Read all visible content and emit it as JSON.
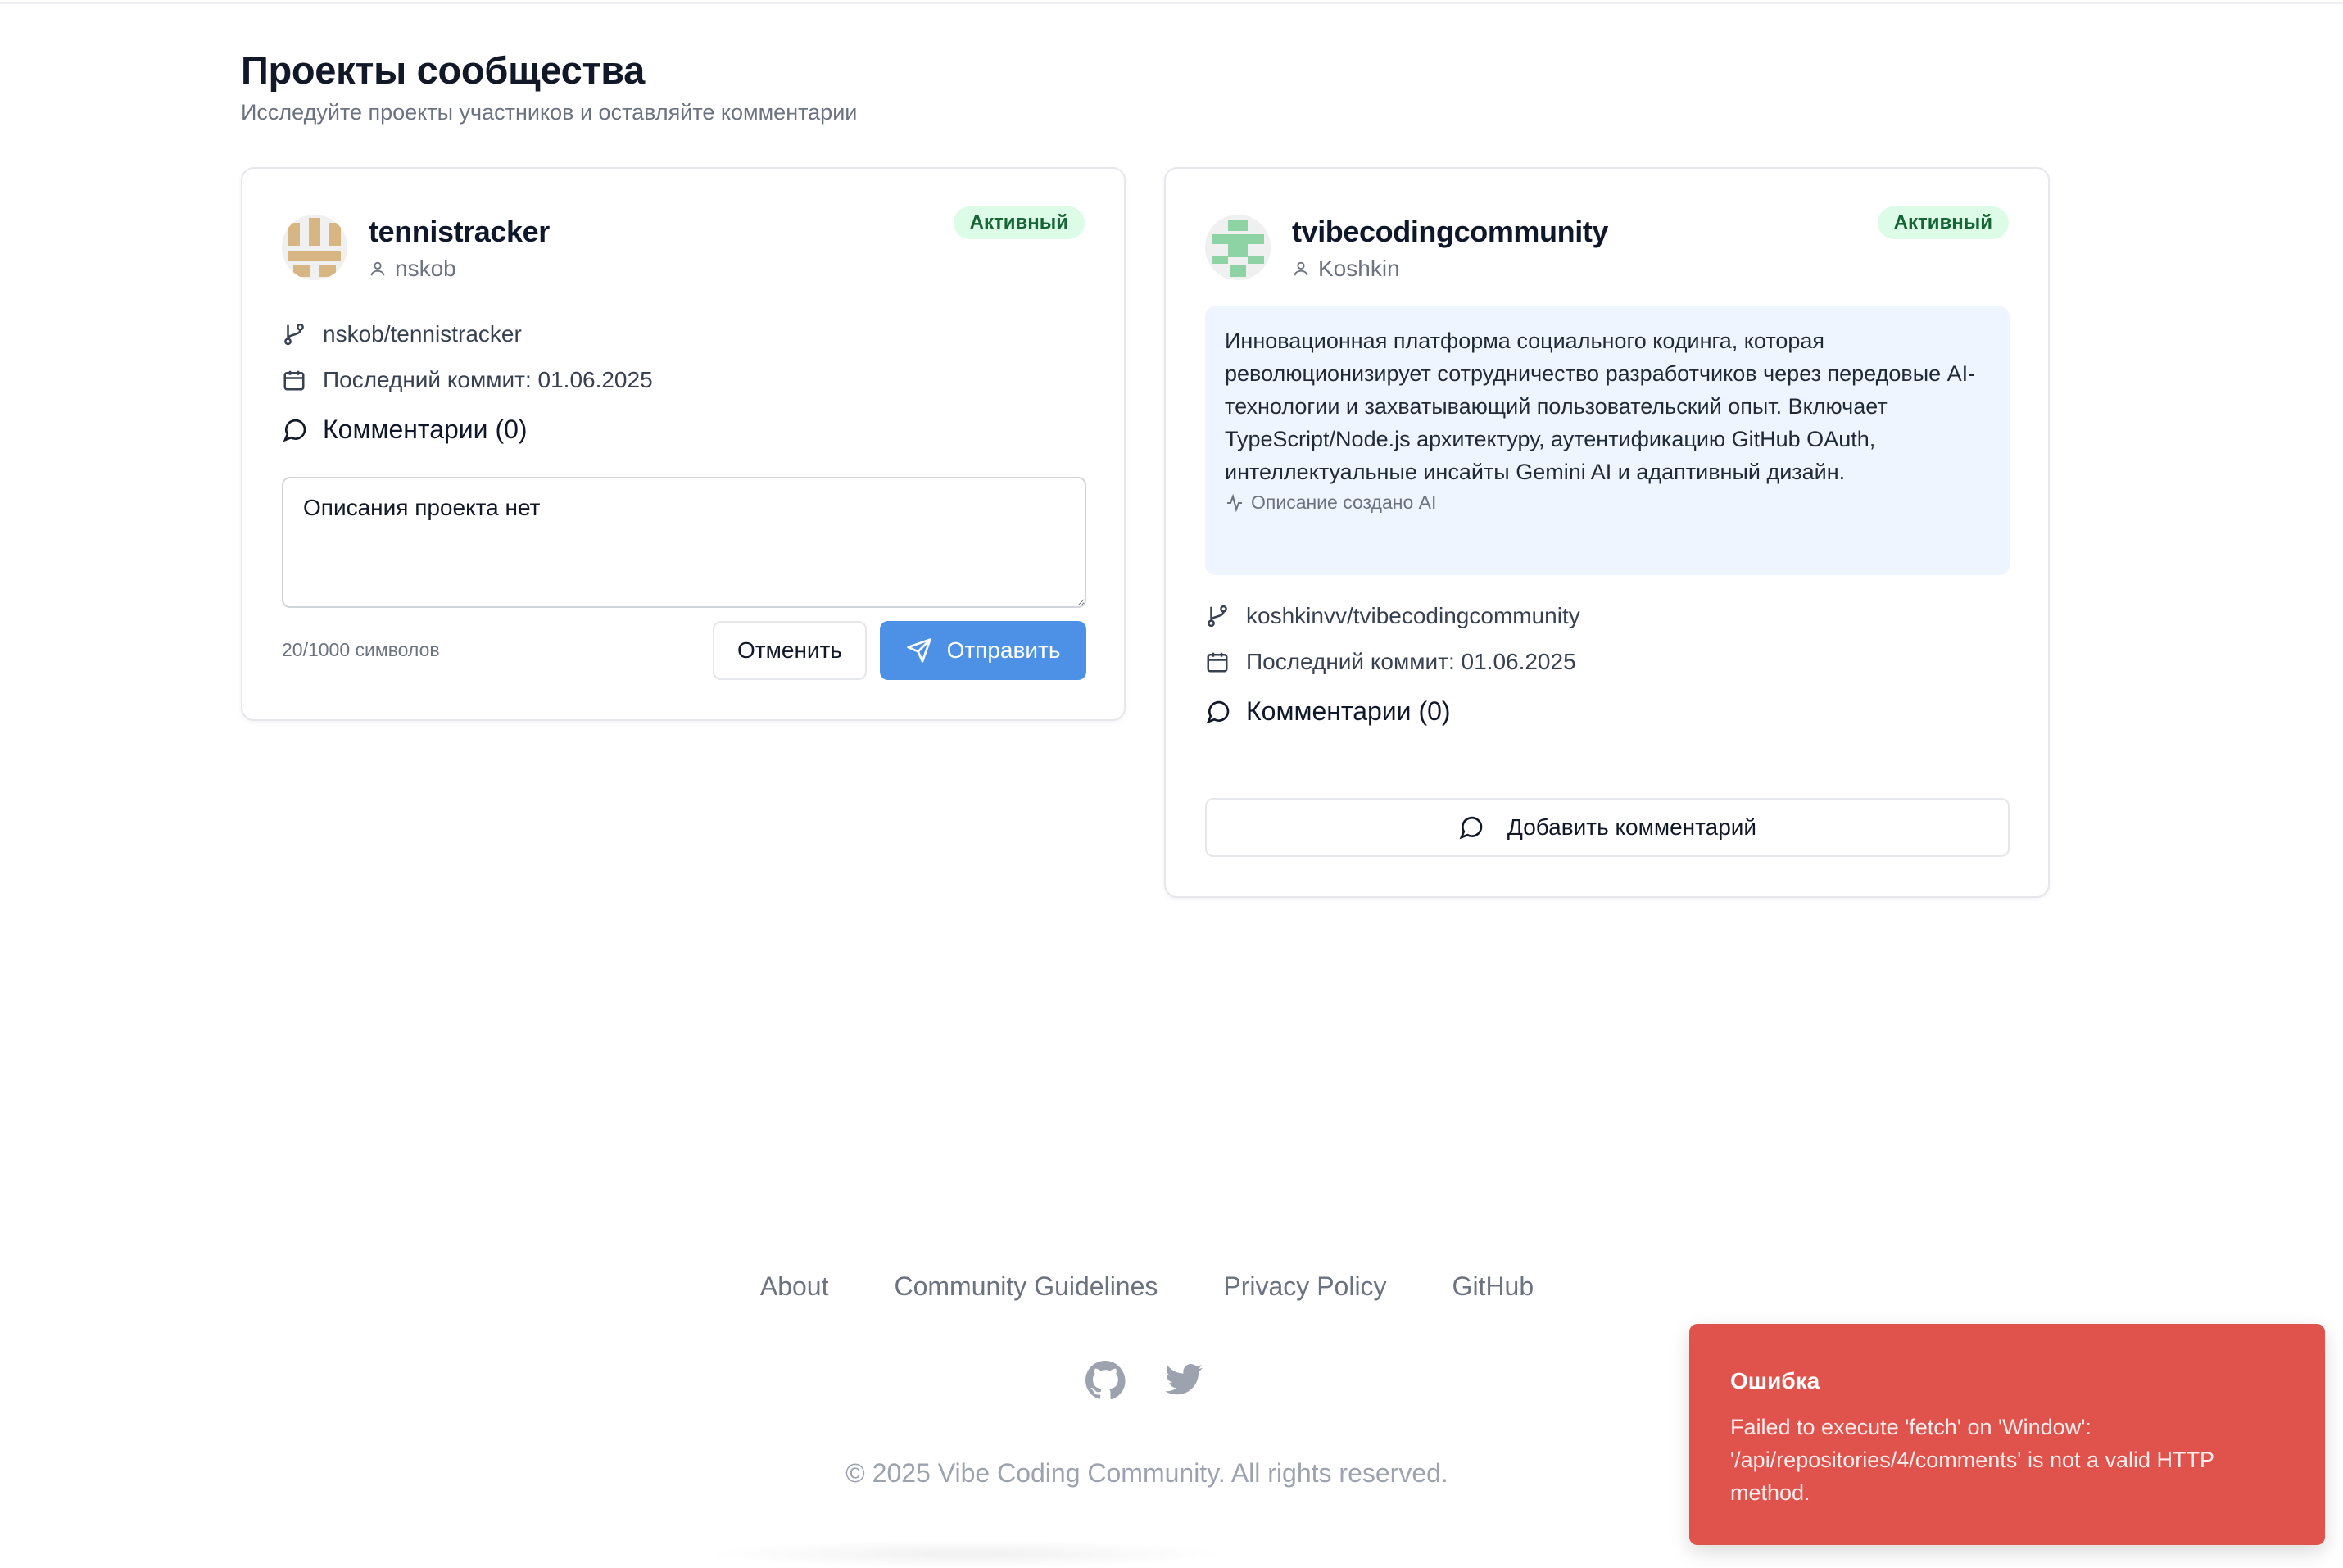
{
  "header": {
    "title": "Проекты сообщества",
    "subtitle": "Исследуйте проекты участников и оставляйте комментарии"
  },
  "projects": [
    {
      "name": "tennistracker",
      "author": "nskob",
      "status": "Активный",
      "repo": "nskob/tennistracker",
      "last_commit": "Последний коммит: 01.06.2025",
      "comments_title": "Комментарии (0)",
      "comment_input_value": "Описания проекта нет",
      "char_count": "20/1000 символов",
      "cancel_label": "Отменить",
      "send_label": "Отправить"
    },
    {
      "name": "tvibecodingcommunity",
      "author": "Koshkin",
      "status": "Активный",
      "description": "Инновационная платформа социального кодинга, которая революционизирует сотрудничество разработчиков через передовые AI-технологии и захватывающий пользовательский опыт. Включает TypeScript/Node.js архитектуру, аутентификацию GitHub OAuth, интеллектуальные инсайты Gemini AI и адаптивный дизайн.",
      "description_note": "Описание создано AI",
      "repo": "koshkinvv/tvibecodingcommunity",
      "last_commit": "Последний коммит: 01.06.2025",
      "comments_title": "Комментарии (0)",
      "add_comment_label": "Добавить комментарий"
    }
  ],
  "footer": {
    "links": [
      "About",
      "Community Guidelines",
      "Privacy Policy",
      "GitHub"
    ],
    "icons": [
      "github-icon",
      "twitter-icon"
    ],
    "copyright": "© 2025 Vibe Coding Community. All rights reserved."
  },
  "toast": {
    "title": "Ошибка",
    "message": "Failed to execute 'fetch' on 'Window': '/api/repositories/4/comments' is not a valid HTTP method."
  },
  "colors": {
    "accent": "#4c91e6",
    "badge_bg": "#dcfce7",
    "badge_text": "#166534",
    "error": "#e0524c",
    "description_bg": "#eef5ff"
  }
}
